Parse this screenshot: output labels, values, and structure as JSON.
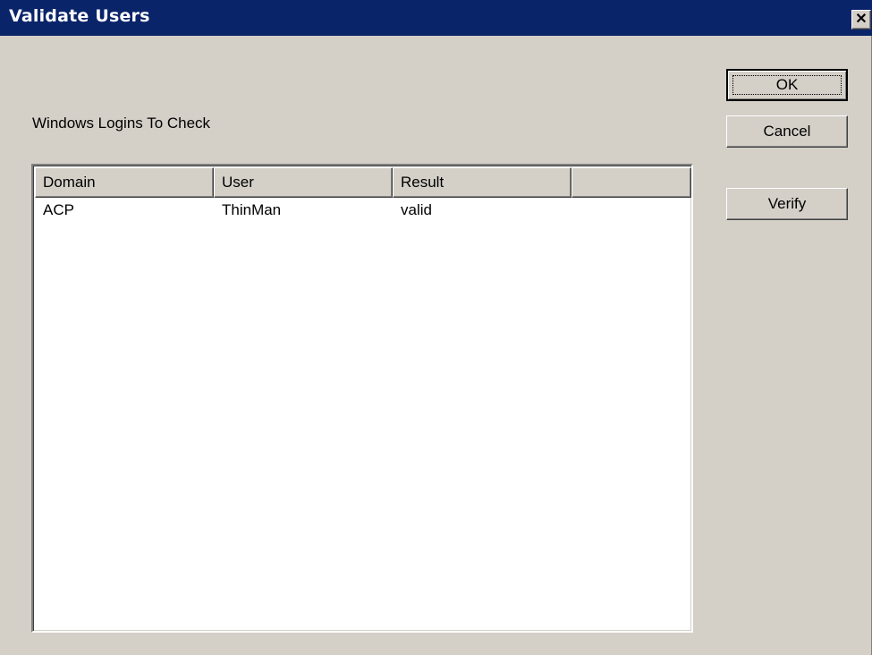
{
  "window": {
    "title": "Validate Users",
    "close_glyph": "✕"
  },
  "label": "Windows Logins To Check",
  "list": {
    "columns": [
      "Domain",
      "User",
      "Result",
      ""
    ],
    "rows": [
      {
        "domain": "ACP",
        "user": "ThinMan",
        "result": "valid"
      }
    ]
  },
  "buttons": {
    "ok": "OK",
    "cancel": "Cancel",
    "verify": "Verify"
  },
  "colors": {
    "titlebar": "#0a246a",
    "dialog_bg": "#d4d0c8"
  }
}
